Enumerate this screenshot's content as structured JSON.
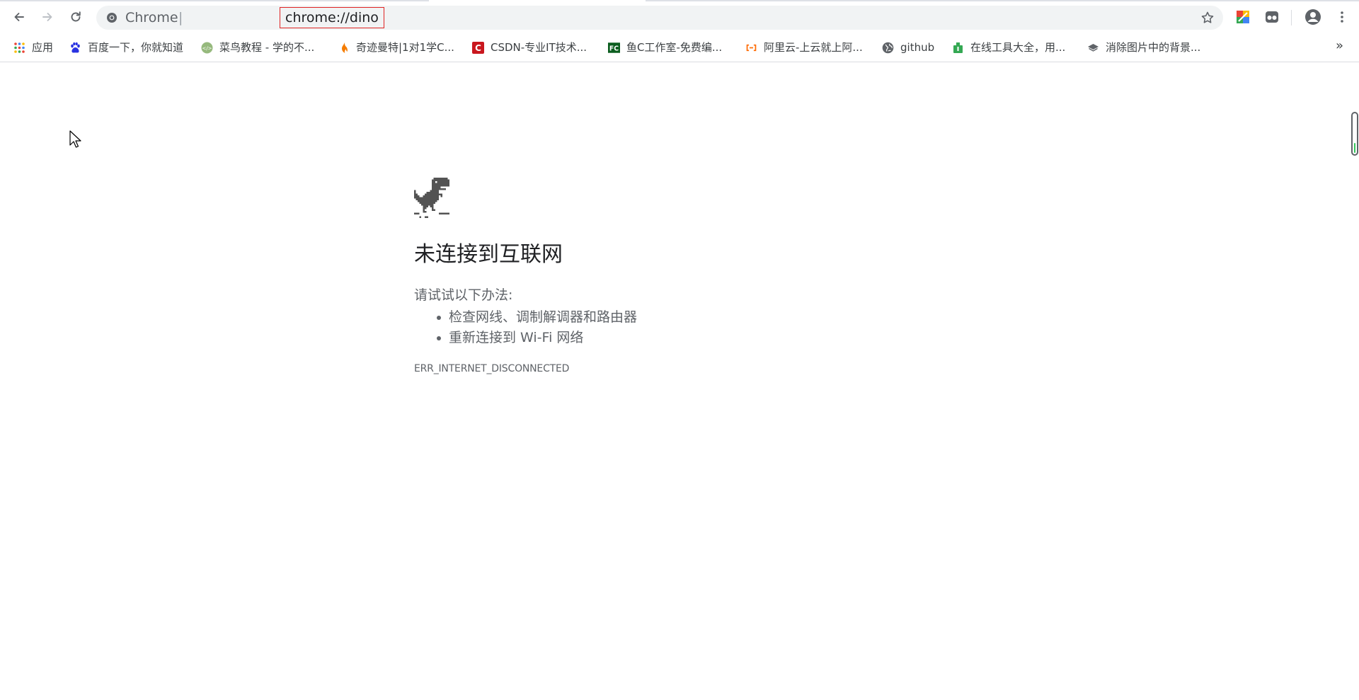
{
  "toolbar": {
    "omnibox": {
      "site_label": "Chrome",
      "separator": "|",
      "url": "chrome://dino"
    }
  },
  "bookmarks": {
    "items": [
      {
        "label": "应用",
        "icon": "apps-grid-icon"
      },
      {
        "label": "百度一下，你就知道",
        "icon": "baidu-paw-icon"
      },
      {
        "label": "菜鸟教程 - 学的不...",
        "icon": "runoob-icon"
      },
      {
        "label": "奇迹曼特|1对1学C...",
        "icon": "flame-logo-icon"
      },
      {
        "label": "CSDN-专业IT技术...",
        "icon": "csdn-icon"
      },
      {
        "label": "鱼C工作室-免费编...",
        "icon": "fishc-icon"
      },
      {
        "label": "阿里云-上云就上阿...",
        "icon": "aliyun-icon"
      },
      {
        "label": "github",
        "icon": "globe-icon"
      },
      {
        "label": "在线工具大全，用...",
        "icon": "tools-icon"
      },
      {
        "label": "消除图片中的背景...",
        "icon": "layers-icon"
      }
    ],
    "overflow": "»"
  },
  "error_page": {
    "title": "未连接到互联网",
    "intro": "请试试以下办法:",
    "suggestions": [
      "检查网线、调制解调器和路由器",
      "重新连接到 Wi-Fi 网络"
    ],
    "code": "ERR_INTERNET_DISCONNECTED"
  },
  "colors": {
    "url_highlight_border": "#e02424",
    "text_primary": "#202124",
    "text_secondary": "#5f6368"
  }
}
